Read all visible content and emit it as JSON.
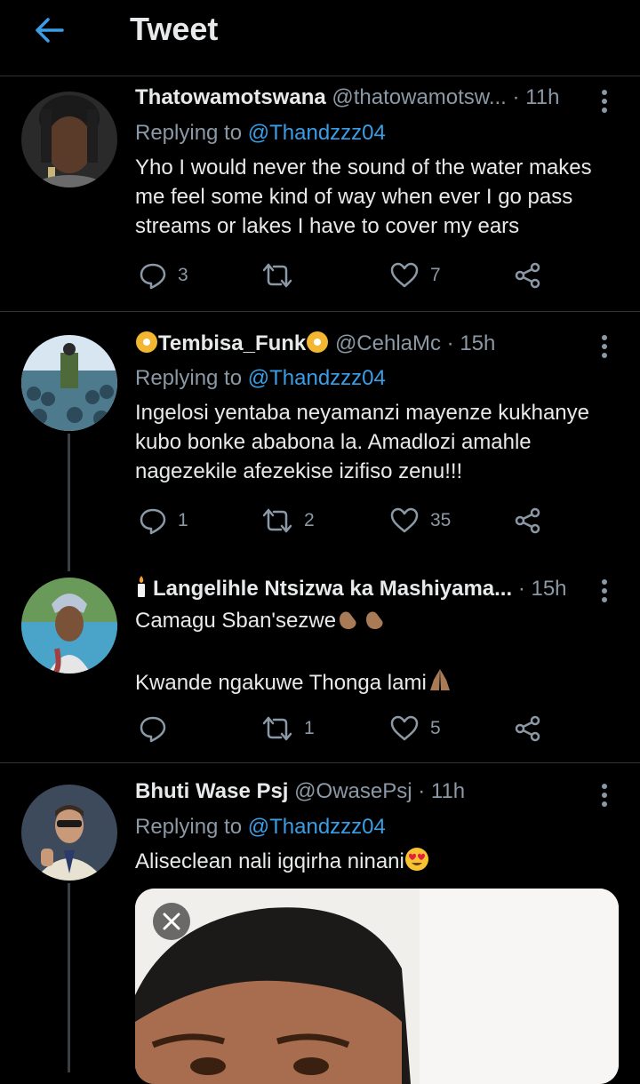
{
  "header": {
    "title": "Tweet"
  },
  "tweets": [
    {
      "name": "Thatowamotswana",
      "handle": "@thatowamotsw...",
      "time": "· 11h",
      "replying_prefix": "Replying to",
      "replying_to": "@Thandzzz04",
      "lines": [
        "Yho I would never the sound of the water makes",
        "me feel some kind of way when ever I go pass",
        "streams or lakes I  have to cover my ears"
      ],
      "reply_count": "3",
      "retweet_count": "",
      "like_count": "7"
    },
    {
      "name": "Tembisa_Funk",
      "handle": "@CehlaMc",
      "time": "· 15h",
      "replying_prefix": "Replying to",
      "replying_to": "@Thandzzz04",
      "lines": [
        "Ingelosi yentaba neyamanzi mayenze kukhanye",
        "kubo bonke ababona la.  Amadlozi amahle",
        "nagezekile afezekise izifiso zenu!!!"
      ],
      "reply_count": "1",
      "retweet_count": "2",
      "like_count": "35"
    },
    {
      "name": "Langelihle Ntsizwa ka Mashiyama...",
      "time": "· 15h",
      "lines": [
        "Camagu Sban'sezwe",
        "Kwande ngakuwe Thonga lami"
      ],
      "reply_count": "",
      "retweet_count": "1",
      "like_count": "5"
    },
    {
      "name": "Bhuti Wase Psj",
      "handle": "@OwasePsj",
      "time": "· 11h",
      "replying_prefix": "Replying to",
      "replying_to": "@Thandzzz04",
      "lines": [
        "Aliseclean nali igqirha ninani"
      ]
    }
  ],
  "colors": {
    "accent": "#3a9ee6",
    "background": "#000000",
    "muted": "#8b98a5"
  }
}
